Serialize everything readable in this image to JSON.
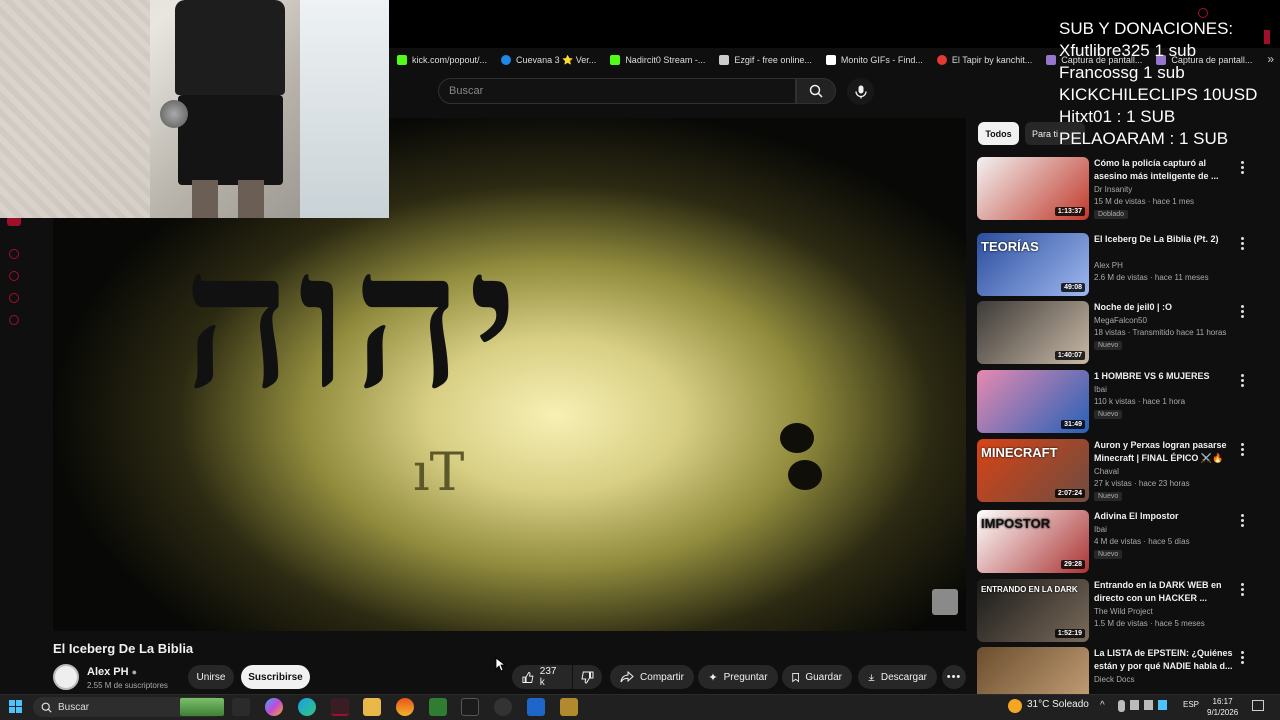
{
  "overlay": {
    "lines": [
      "SUB Y DONACIONES:",
      "Xfutlibre325 1 sub",
      "Francossg 1 sub",
      "KICKCHILECLIPS 10USD",
      "Hitxt01 : 1 SUB",
      "PELAOARAM : 1 SUB"
    ]
  },
  "bookmarks": [
    {
      "label": "kick.com/popout/...",
      "color": "#53fc18",
      "icon": "kick-icon"
    },
    {
      "label": "Cuevana 3 ⭐ Ver...",
      "color": "#1e88e5",
      "icon": "cuevana-icon"
    },
    {
      "label": "Nadircit0 Stream -...",
      "color": "#53fc18",
      "icon": "kick-icon"
    },
    {
      "label": "Ezgif - free online...",
      "color": "#cccccc",
      "icon": "ezgif-icon"
    },
    {
      "label": "Monito GIFs - Find...",
      "color": "#ffffff",
      "icon": "document-icon"
    },
    {
      "label": "El Tapir by kanchit...",
      "color": "#e53935",
      "icon": "tapir-icon"
    },
    {
      "label": "Captura de pantall...",
      "color": "#9575cd",
      "icon": "capture-icon"
    },
    {
      "label": "Captura de pantall...",
      "color": "#9575cd",
      "icon": "capture-icon"
    }
  ],
  "search": {
    "placeholder": "Buscar"
  },
  "video": {
    "title": "El Iceberg De La Biblia",
    "glyph": "יהוה"
  },
  "channel": {
    "name": "Alex PH",
    "subs": "2.55 M de suscriptores",
    "join": "Unirse",
    "subscribe": "Suscribirse"
  },
  "actions": {
    "likes": "237 k",
    "share": "Compartir",
    "ask": "Preguntar",
    "save": "Guardar",
    "download": "Descargar"
  },
  "chips": {
    "all": "Todos",
    "para": "Para ti"
  },
  "recommendations": [
    {
      "title": "Cómo la policía capturó al asesino más inteligente de ...",
      "channel": "Dr Insanity",
      "meta": "15 M de vistas · hace 1 mes",
      "badge": "Doblado",
      "duration": "1:13:37",
      "colors": [
        "#f2f2f2",
        "#c0392b"
      ]
    },
    {
      "title": "El Iceberg De La Biblia (Pt. 2)",
      "channel": "Alex PH",
      "meta": "2.6 M de vistas · hace 11 meses",
      "badge": "",
      "duration": "49:08",
      "colors": [
        "#2a4d9e",
        "#9fb8ef"
      ],
      "thumb_text": "TEORÍAS"
    },
    {
      "title": "Noche de jeil0 | :O",
      "channel": "MegaFalcon50",
      "meta": "18 vistas · Transmitido hace 11 horas",
      "badge": "Nuevo",
      "duration": "1:40:07",
      "colors": [
        "#3d3a38",
        "#c9b9a6"
      ]
    },
    {
      "title": "1 HOMBRE VS 6 MUJERES",
      "channel": "Ibai",
      "meta": "110 k vistas · hace 1 hora",
      "badge": "Nuevo",
      "duration": "31:49",
      "colors": [
        "#e68ab0",
        "#2561b8"
      ]
    },
    {
      "title": "Auron y Perxas logran pasarse Minecraft | FINAL ÉPICO ⚔️🔥",
      "channel": "Chaval",
      "meta": "27 k vistas · hace 23 horas",
      "badge": "Nuevo",
      "duration": "2:07:24",
      "colors": [
        "#d84315",
        "#6d4c41"
      ],
      "thumb_text": "MINECRAFT"
    },
    {
      "title": "Adivina El Impostor",
      "channel": "Ibai",
      "meta": "4 M de vistas · hace 5 días",
      "badge": "Nuevo",
      "duration": "29:28",
      "colors": [
        "#ffffff",
        "#a33"
      ],
      "thumb_text": "IMPOSTOR"
    },
    {
      "title": "Entrando en la DARK WEB en directo con un HACKER ...",
      "channel": "The Wild Project",
      "meta": "1.5 M de vistas · hace 5 meses",
      "badge": "",
      "duration": "1:52:19",
      "colors": [
        "#1a1a1a",
        "#7a6a5a"
      ],
      "thumb_text": "ENTRANDO EN LA DARK"
    },
    {
      "title": "La LISTA de EPSTEIN: ¿Quiénes están y por qué NADIE habla d...",
      "channel": "Dieck Docs",
      "meta": "",
      "badge": "",
      "duration": "",
      "colors": [
        "#6b4e2e",
        "#c7a27a"
      ]
    }
  ],
  "taskbar": {
    "search": "Buscar",
    "weather": "31°C  Soleado",
    "lang": "ESP",
    "time": "16:17",
    "date": "9/1/2026"
  },
  "brand": {
    "accent": "#a0102b",
    "youtube_red": "#ff0000"
  }
}
